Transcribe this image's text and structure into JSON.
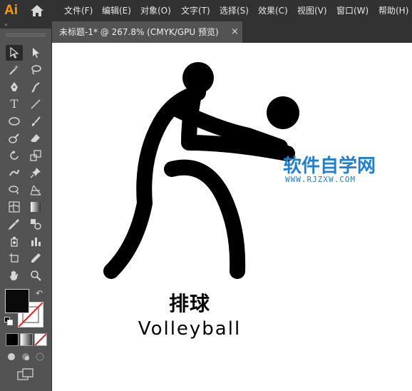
{
  "app": {
    "logo": "Ai"
  },
  "menu": [
    {
      "label": "文件(F)"
    },
    {
      "label": "编辑(E)"
    },
    {
      "label": "对象(O)"
    },
    {
      "label": "文字(T)"
    },
    {
      "label": "选择(S)"
    },
    {
      "label": "效果(C)"
    },
    {
      "label": "视图(V)"
    },
    {
      "label": "窗口(W)"
    },
    {
      "label": "帮助(H)"
    }
  ],
  "panel": {
    "collapse_icon": "«"
  },
  "document_tab": {
    "title": "未标题-1* @ 267.8% (CMYK/GPU 预览)",
    "close": "×"
  },
  "tools": {
    "selection": "selection-icon",
    "direct_selection": "direct-selection-icon",
    "type": "T",
    "colors": {
      "fill": "#0a0a0a",
      "stroke_none": "#e02020",
      "accent_watermark": "#1f7fd0"
    }
  },
  "artwork": {
    "caption_cn": "排球",
    "caption_en": "Volleyball"
  },
  "watermark": {
    "text": "软件自学网",
    "url": "WWW.RJZXW.COM"
  }
}
